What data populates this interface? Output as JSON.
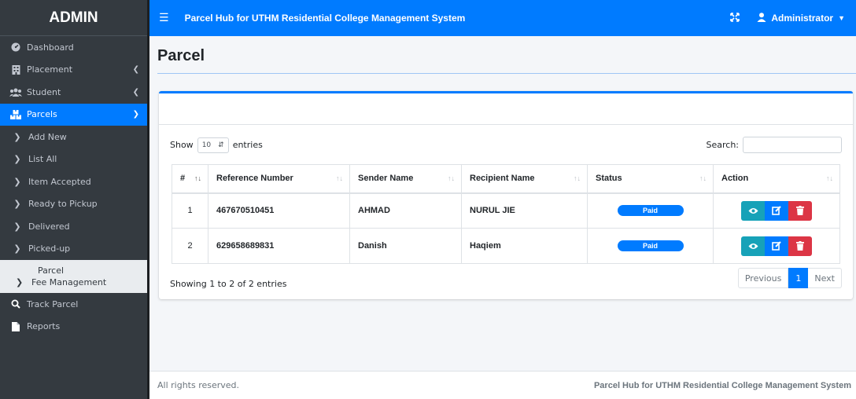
{
  "brand": "ADMIN",
  "sidebar": {
    "items": [
      {
        "label": "Dashboard",
        "icon": "dashboard-icon"
      },
      {
        "label": "Placement",
        "icon": "building-icon"
      },
      {
        "label": "Student",
        "icon": "users-icon"
      },
      {
        "label": "Parcels",
        "icon": "boxes-icon"
      }
    ],
    "sub_items": [
      {
        "label": "Add New"
      },
      {
        "label": "List All"
      },
      {
        "label": "Item Accepted"
      },
      {
        "label": "Ready to Pickup"
      },
      {
        "label": "Delivered"
      },
      {
        "label": "Picked-up"
      }
    ],
    "parcel_label": "Parcel",
    "fee_management": "Fee Management",
    "track_parcel": "Track Parcel",
    "reports": "Reports"
  },
  "topbar": {
    "title": "Parcel Hub for UTHM Residential College Management System",
    "user": "Administrator"
  },
  "page": {
    "title": "Parcel"
  },
  "table": {
    "show_label": "Show",
    "entries_value": "10",
    "entries_label": "entries",
    "search_label": "Search:",
    "columns": [
      "#",
      "Reference Number",
      "Sender Name",
      "Recipient Name",
      "Status",
      "Action"
    ],
    "rows": [
      {
        "no": "1",
        "ref": "467670510451",
        "sender": "AHMAD",
        "recipient": "NURUL JIE",
        "status": "Paid"
      },
      {
        "no": "2",
        "ref": "629658689831",
        "sender": "Danish",
        "recipient": "Haqiem",
        "status": "Paid"
      }
    ],
    "info": "Showing 1 to 2 of 2 entries",
    "pagination": {
      "previous": "Previous",
      "current": "1",
      "next": "Next"
    }
  },
  "footer": {
    "left": "All rights reserved.",
    "right": "Parcel Hub for UTHM Residential College Management System"
  },
  "colors": {
    "primary": "#007bff",
    "sidebar": "#343a40",
    "info": "#17a2b8",
    "danger": "#dc3545"
  }
}
